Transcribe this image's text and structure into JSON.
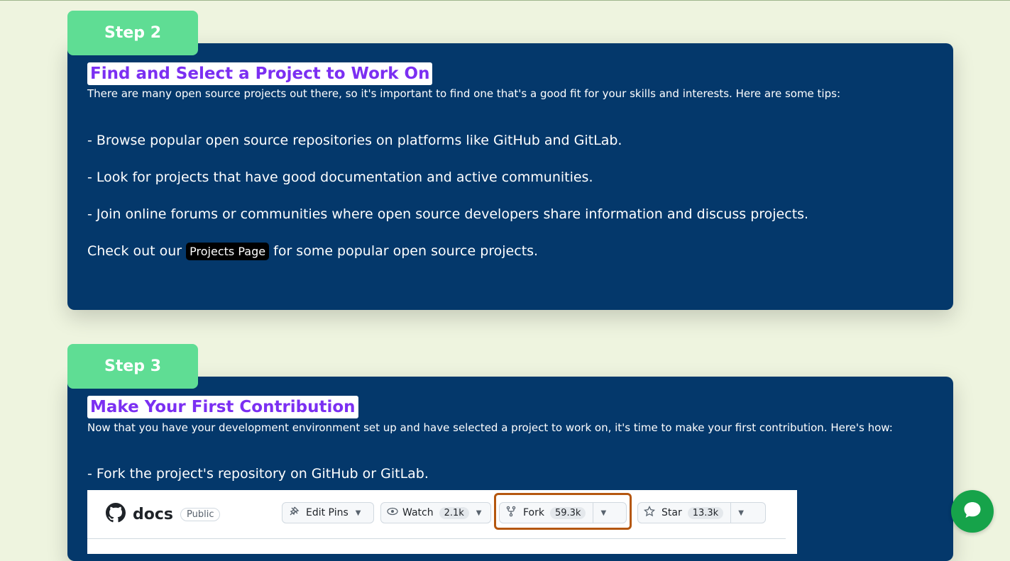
{
  "step2": {
    "tab": "Step 2",
    "title": "Find and Select a Project to Work On",
    "intro": "There are many open source projects out there, so it's important to find one that's a good fit for your skills and interests. Here are some tips:",
    "tips": [
      "- Browse popular open source repositories on platforms like GitHub and GitLab.",
      "- Look for projects that have good documentation and active communities.",
      "- Join online forums or communities where open source developers share information and discuss projects."
    ],
    "cta_prefix": "Check out our",
    "cta_link": "Projects Page",
    "cta_suffix": "for some popular open source projects."
  },
  "step3": {
    "tab": "Step 3",
    "title": "Make Your First Contribution",
    "intro": "Now that you have your development environment set up and have selected a project to work on, it's time to make your first contribution. Here's how:",
    "tips": [
      "- Fork the project's repository on GitHub or GitLab."
    ]
  },
  "github_screenshot": {
    "repo": "docs",
    "visibility": "Public",
    "edit_pins": "Edit Pins",
    "watch": "Watch",
    "watch_count": "2.1k",
    "fork": "Fork",
    "fork_count": "59.3k",
    "star": "Star",
    "star_count": "13.3k",
    "highlight_color": "#b5570f"
  },
  "chat": {
    "icon": "chat-bubble-icon",
    "color": "#16a34a"
  }
}
